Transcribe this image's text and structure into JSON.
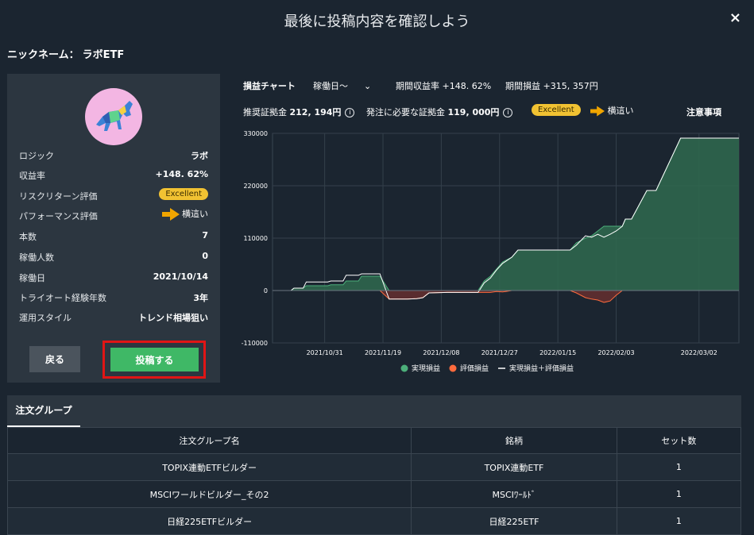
{
  "header": {
    "title": "最後に投稿内容を確認しよう",
    "close_icon": "×"
  },
  "nickname": {
    "label": "ニックネーム：",
    "value": "ラボETF"
  },
  "profile": {
    "rows": [
      {
        "key": "ロジック",
        "value": "ラボ"
      },
      {
        "key": "収益率",
        "value": "+148. 62%"
      },
      {
        "key": "リスクリターン評価",
        "value": "Excellent"
      },
      {
        "key": "パフォーマンス評価",
        "value": "横這い"
      },
      {
        "key": "本数",
        "value": "7"
      },
      {
        "key": "稼働人数",
        "value": "0"
      },
      {
        "key": "稼働日",
        "value": "2021/10/14"
      },
      {
        "key": "トライオート経験年数",
        "value": "3年"
      },
      {
        "key": "運用スタイル",
        "value": "トレンド相場狙い"
      }
    ],
    "back_label": "戻る",
    "post_label": "投稿する"
  },
  "chart_header": {
    "chart_label": "損益チャート",
    "period_select": "稼働日〜",
    "chevron": "⌄",
    "yield_label": "期間収益率",
    "yield_value": "+148. 62%",
    "pnl_label": "期間損益",
    "pnl_value": "+315, 357円",
    "recommended_label": "推奨証拠金",
    "recommended_value": "212, 194円",
    "required_label": "発注に必要な証拠金",
    "required_value": "119, 000円",
    "info_glyph": "i",
    "badge": "Excellent",
    "trend": "横這い",
    "notes": "注意事項"
  },
  "chart_data": {
    "type": "area",
    "ylim": [
      -110000,
      330000
    ],
    "yticks": [
      330000,
      220000,
      110000,
      0,
      -110000
    ],
    "ytick_labels": [
      "330000",
      "220000",
      "110000",
      "0",
      "-110000"
    ],
    "xtick_labels": [
      "2021/10/31",
      "2021/11/19",
      "2021/12/08",
      "2021/12/27",
      "2022/01/15",
      "2022/02/03",
      "2022/03/02"
    ],
    "start": "2021/10/14",
    "end": "2022/03/15",
    "dates": [
      "2021/10/14",
      "2021/10/20",
      "2021/10/21",
      "2021/10/24",
      "2021/10/25",
      "2021/11/01",
      "2021/11/02",
      "2021/11/06",
      "2021/11/07",
      "2021/11/11",
      "2021/11/12",
      "2021/11/18",
      "2021/11/21",
      "2021/11/22",
      "2021/11/27",
      "2021/11/30",
      "2021/12/02",
      "2021/12/04",
      "2021/12/10",
      "2021/12/16",
      "2021/12/20",
      "2021/12/22",
      "2021/12/24",
      "2021/12/26",
      "2021/12/28",
      "2021/12/31",
      "2022/01/02",
      "2022/01/05",
      "2022/01/10",
      "2022/01/15",
      "2022/01/19",
      "2022/01/21",
      "2022/01/24",
      "2022/01/26",
      "2022/01/28",
      "2022/01/30",
      "2022/02/01",
      "2022/02/03",
      "2022/02/05",
      "2022/02/06",
      "2022/02/08",
      "2022/02/13",
      "2022/02/15",
      "2022/02/16",
      "2022/02/24",
      "2022/02/26",
      "2022/03/02",
      "2022/03/15"
    ],
    "series": [
      {
        "name": "実現損益",
        "color": "#4caf7a",
        "values": [
          0,
          0,
          5000,
          5000,
          10000,
          10000,
          12000,
          12000,
          20000,
          20000,
          30000,
          30000,
          0,
          0,
          0,
          0,
          0,
          0,
          0,
          0,
          0,
          20000,
          30000,
          45000,
          60000,
          70000,
          85000,
          85000,
          85000,
          85000,
          85000,
          100000,
          110000,
          115000,
          125000,
          135000,
          135000,
          135000,
          135000,
          150000,
          150000,
          210000,
          210000,
          210000,
          320000,
          320000,
          320000,
          320000
        ]
      },
      {
        "name": "評価損益",
        "color": "#ff6b3d",
        "values": [
          0,
          0,
          0,
          0,
          0,
          0,
          0,
          0,
          0,
          0,
          0,
          0,
          -18000,
          -18000,
          -18000,
          -17000,
          -15000,
          -5000,
          -4000,
          -4000,
          -4000,
          -4000,
          -4000,
          -2000,
          -3000,
          0,
          0,
          0,
          0,
          0,
          0,
          -5000,
          -15000,
          -18000,
          -20000,
          -25000,
          -22000,
          -10000,
          0,
          0,
          0,
          0,
          0,
          0,
          0,
          0,
          0,
          0
        ]
      },
      {
        "name": "実現損益＋評価損益",
        "color": "#ffffff",
        "values": [
          0,
          0,
          5000,
          5000,
          18000,
          18000,
          20000,
          20000,
          32000,
          32000,
          35000,
          35000,
          -18000,
          -18000,
          -18000,
          -17000,
          -15000,
          -5000,
          -4000,
          -4000,
          -4000,
          16000,
          26000,
          43000,
          57000,
          70000,
          85000,
          85000,
          85000,
          85000,
          85000,
          95000,
          115000,
          112000,
          118000,
          112000,
          118000,
          125000,
          135000,
          150000,
          150000,
          210000,
          210000,
          210000,
          320000,
          320000,
          320000,
          320000
        ]
      }
    ],
    "legend": [
      "実現損益",
      "評価損益",
      "実現損益＋評価損益"
    ],
    "legend_position": "bottom",
    "grid": true
  },
  "orders": {
    "tab_label": "注文グループ",
    "columns": [
      "注文グループ名",
      "銘柄",
      "セット数"
    ],
    "rows": [
      [
        "TOPIX連動ETFビルダー",
        "TOPIX連動ETF",
        "1"
      ],
      [
        "MSCIワールドビルダー_その2",
        "MSCIﾜｰﾙﾄﾞ",
        "1"
      ],
      [
        "日経225ETFビルダー",
        "日経225ETF",
        "1"
      ]
    ]
  }
}
